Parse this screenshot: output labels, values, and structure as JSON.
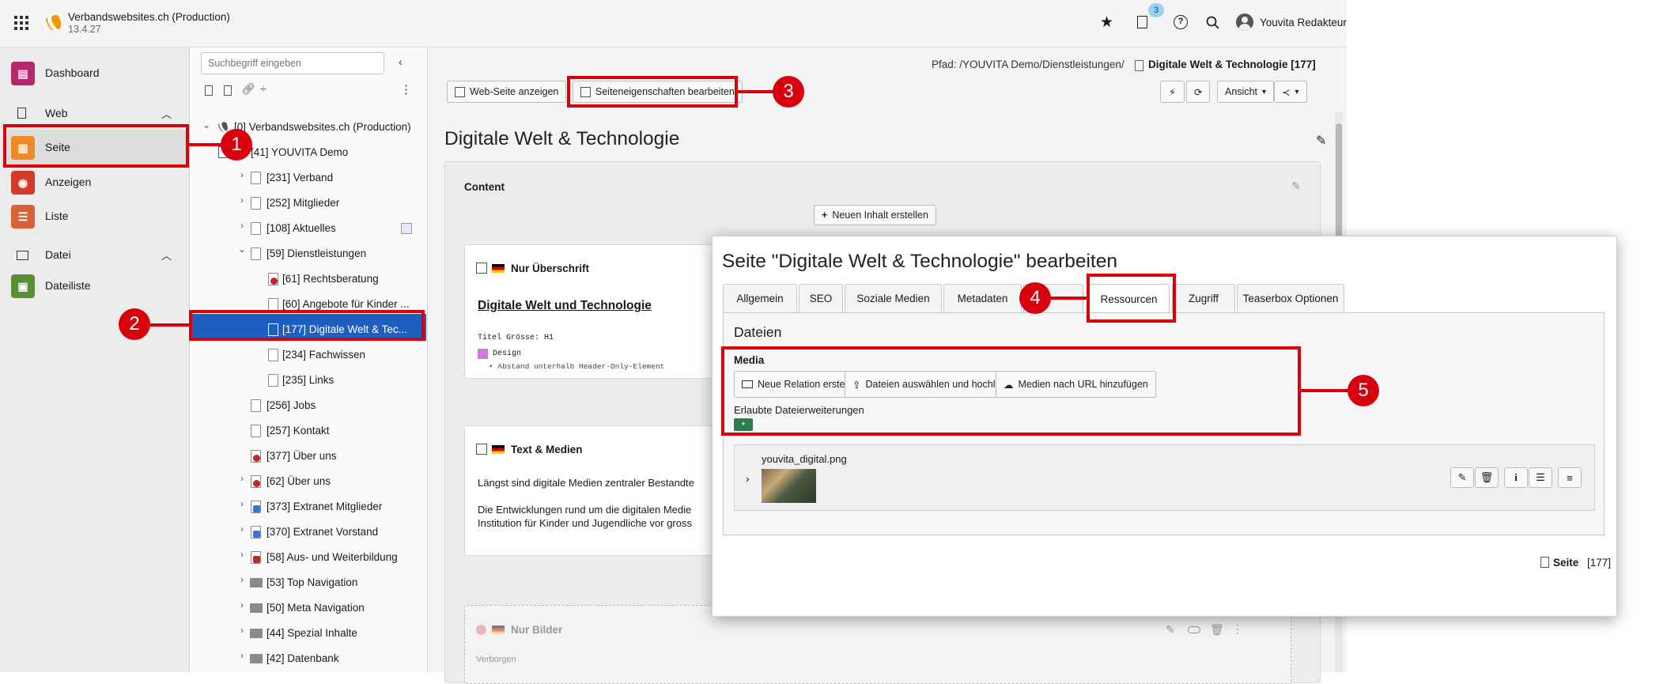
{
  "topbar": {
    "site_name": "Verbandswebsites.ch (Production)",
    "version": "13.4.27",
    "notification_count": "3",
    "user_name": "Youvita Redakteur"
  },
  "modules": {
    "dashboard": "Dashboard",
    "web_group": "Web",
    "seite": "Seite",
    "anzeigen": "Anzeigen",
    "liste": "Liste",
    "datei_group": "Datei",
    "dateiliste": "Dateiliste"
  },
  "tree": {
    "search_placeholder": "Suchbegriff eingeben",
    "root": "[0] Verbandswebsites.ch (Production)",
    "nodes": [
      "[41] YOUVITA Demo",
      "[231] Verband",
      "[252] Mitglieder",
      "[108] Aktuelles",
      "[59] Dienstleistungen",
      "[61] Rechtsberatung",
      "[60] Angebote für Kinder ...",
      "[177] Digitale Welt & Tec...",
      "[234] Fachwissen",
      "[235] Links",
      "[256] Jobs",
      "[257] Kontakt",
      "[377] Über uns",
      "[62] Über uns",
      "[373] Extranet Mitglieder",
      "[370] Extranet Vorstand",
      "[58] Aus- und Weiterbildung",
      "[53] Top Navigation",
      "[50] Meta Navigation",
      "[44] Spezial Inhalte",
      "[42] Datenbank"
    ]
  },
  "content": {
    "path_label": "Pfad: /YOUVITA Demo/Dienstleistungen/",
    "path_page": "Digitale Welt & Technologie [177]",
    "btn_view": "Web-Seite anzeigen",
    "btn_edit_props": "Seiteneigenschaften bearbeiten",
    "btn_ansicht": "Ansicht",
    "page_title": "Digitale Welt & Technologie",
    "column_label": "Content",
    "new_content_btn": "Neuen Inhalt erstellen",
    "el1_type": "Nur Überschrift",
    "el1_heading": "Digitale Welt und Technologie",
    "el1_meta1": "Titel Grösse: H1",
    "el1_meta2": "Design",
    "el1_meta3": "Abstand unterhalb Header-Only-Element",
    "el2_type": "Text & Medien",
    "el2_text1": "Längst sind digitale Medien zentraler Bestandte",
    "el2_text2": "Die Entwicklungen rund um die digitalen Medie",
    "el2_text3": "Institution für Kinder und Jugendliche vor gross",
    "el3_type": "Nur Bilder",
    "el3_hidden": "Verborgen"
  },
  "modal": {
    "title": "Seite \"Digitale Welt & Technologie\" bearbeiten",
    "tabs": [
      "Allgemein",
      "SEO",
      "Soziale Medien",
      "Metadaten",
      "Ressourcen",
      "Zugriff",
      "Teaserbox Optionen"
    ],
    "section_title": "Dateien",
    "media_label": "Media",
    "btn_new_relation": "Neue Relation erstellen",
    "btn_upload": "Dateien auswählen und hochladen",
    "btn_url": "Medien nach URL hinzufügen",
    "allowed_ext_label": "Erlaubte Dateierweiterungen",
    "allowed_ext_value": "*",
    "file_name": "youvita_digital.png",
    "footer_label": "Seite",
    "footer_id": "[177]"
  },
  "callouts": [
    "1",
    "2",
    "3",
    "4",
    "5"
  ],
  "colors": {
    "accent_red": "#d9000e",
    "selected_blue": "#1d5fbf",
    "typo3_orange": "#f49700"
  }
}
